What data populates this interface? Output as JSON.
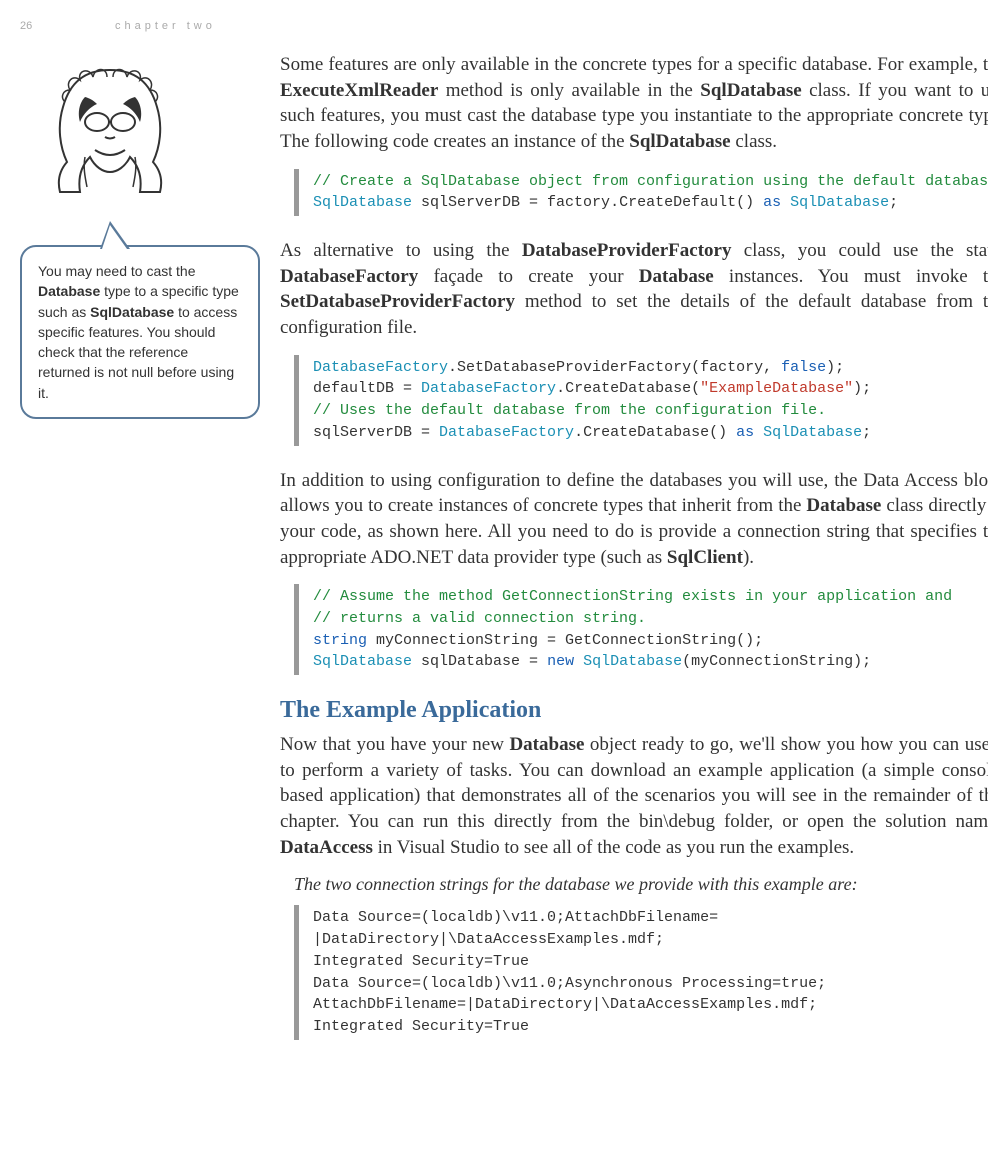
{
  "header": {
    "page_num": "26",
    "chapter": "chapter two"
  },
  "callout": {
    "text_before_b1": "You may need to cast the ",
    "b1": "Database",
    "text_mid1": " type to a specific type such as ",
    "b2": "SqlDatabase",
    "text_after": " to access specific features. You should check that the reference returned is not null before using it."
  },
  "para1": {
    "t0": "Some features are only available in the concrete types for a specific database. For example, the ",
    "b1": "ExecuteXmlReader",
    "t1": " method is only available in the ",
    "b2": "SqlData­base",
    "t2": " class. If you want to use such features, you must cast the database type you instantiate to the appropriate concrete type. The following code creates an in­stance of the ",
    "b3": "SqlDatabase",
    "t3": " class."
  },
  "code1": {
    "l1_cm": "// Create a SqlDatabase object from configuration using the default database.",
    "l2_tp": "SqlDatabase",
    "l2_txt": " sqlServerDB = factory.CreateDefault() ",
    "l2_kw": "as",
    "l2_sp": " ",
    "l2_tp2": "SqlDatabase",
    "l2_end": ";"
  },
  "para2": {
    "t0": "As alternative to using the ",
    "b1": "DatabaseProviderFactory",
    "t1": " class, you could use the static ",
    "b2": "DatabaseFactory",
    "t2": " façade to create your ",
    "b3": "Database",
    "t3": " instances. You must invoke the ",
    "b4": "SetDatabaseProviderFactory",
    "t4": " method to set the details of the de­fault database from the configuration file."
  },
  "code2": {
    "l1_tp": "DatabaseFactory",
    "l1_txt": ".SetDatabaseProviderFactory(factory, ",
    "l1_kw": "false",
    "l1_end": ");",
    "l2_a": "defaultDB = ",
    "l2_tp": "DatabaseFactory",
    "l2_b": ".CreateDatabase(",
    "l2_st": "\"ExampleDatabase\"",
    "l2_end": ");",
    "l3_cm": "// Uses the default database from the configuration file.",
    "l4_a": "sqlServerDB = ",
    "l4_tp": "DatabaseFactory",
    "l4_b": ".CreateDatabase() ",
    "l4_kw": "as",
    "l4_sp": " ",
    "l4_tp2": "SqlDatabase",
    "l4_end": ";"
  },
  "para3": {
    "t0": "In addition to using configuration to define the databases you will use, the Data Access block allows you to create instances of concrete types that inherit from the ",
    "b1": "Database",
    "t1": " class directly in your code, as shown here. All you need to do is provide a connection string that specifies the appropriate ADO.NET data pro­vider type (such as ",
    "b2": "SqlClient",
    "t2": ")."
  },
  "code3": {
    "l1_cm": "// Assume the method GetConnectionString exists in your application and",
    "l2_cm": "// returns a valid connection string.",
    "l3_kw": "string",
    "l3_txt": " myConnectionString = GetConnectionString();",
    "l4_tp": "SqlDatabase",
    "l4_a": " sqlDatabase = ",
    "l4_kw": "new",
    "l4_sp": " ",
    "l4_tp2": "SqlDatabase",
    "l4_end": "(myConnectionString);"
  },
  "heading1": "The Example Application",
  "para4": {
    "t0": "Now that you have your new ",
    "b1": "Database",
    "t1": " object ready to go, we'll show you how you can use it to perform a variety of tasks. You can download an example ap­plication (a simple console-based application) that demonstrates all of the sce­narios you will see in the remainder of this chapter. You can run this directly from the bin\\debug folder, or open the solution named ",
    "b2": "DataAccess",
    "t2": " in Visual Studio to see all of the code as you run the examples."
  },
  "intro1": "The two connection strings for the database we provide with this example are:",
  "code4": {
    "l1": "Data Source=(localdb)\\v11.0;AttachDbFilename=",
    "l2": "|DataDirectory|\\DataAccessExamples.mdf;",
    "l3": "Integrated Security=True",
    "l4": "Data Source=(localdb)\\v11.0;Asynchronous Processing=true;",
    "l5": "AttachDbFilename=|DataDirectory|\\DataAccessExamples.mdf;",
    "l6": "Integrated Security=True"
  }
}
